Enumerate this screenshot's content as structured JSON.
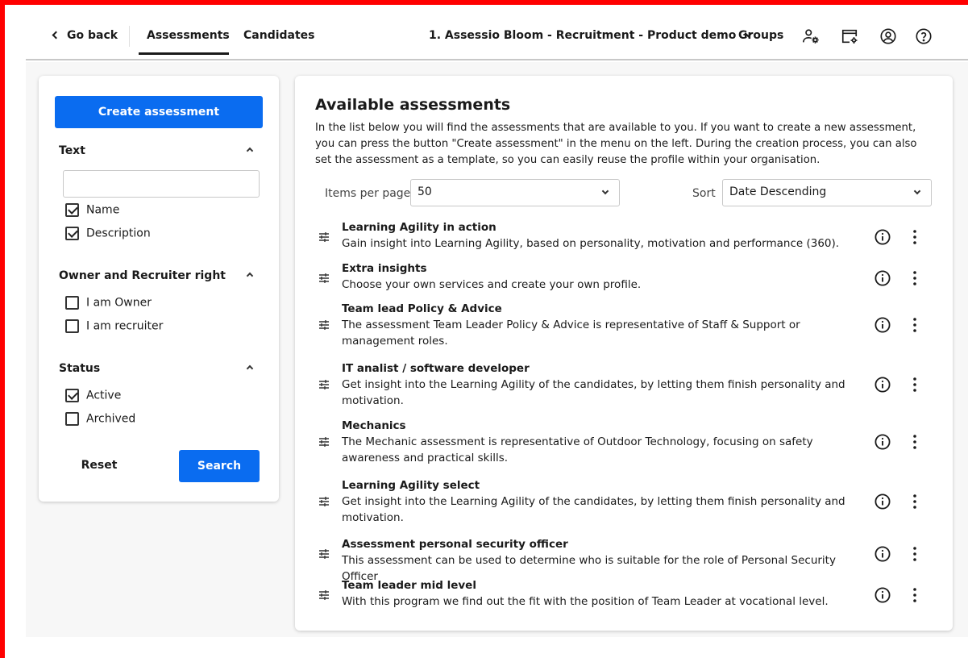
{
  "nav": {
    "back_label": "Go back",
    "tabs": [
      {
        "label": "Assessments",
        "active": true
      },
      {
        "label": "Candidates",
        "active": false
      }
    ],
    "project_label": "1. Assessio Bloom - Recruitment - Product demo",
    "groups_label": "Groups",
    "icons": [
      "user-settings-icon",
      "window-settings-icon",
      "account-icon",
      "help-icon"
    ]
  },
  "sidebar": {
    "create_label": "Create assessment",
    "sections": {
      "text": {
        "title": "Text",
        "input_value": "",
        "options": [
          {
            "label": "Name",
            "checked": true
          },
          {
            "label": "Description",
            "checked": true
          }
        ]
      },
      "owner": {
        "title": "Owner and Recruiter right",
        "options": [
          {
            "label": "I am Owner",
            "checked": false
          },
          {
            "label": "I am recruiter",
            "checked": false
          }
        ]
      },
      "status": {
        "title": "Status",
        "options": [
          {
            "label": "Active",
            "checked": true
          },
          {
            "label": "Archived",
            "checked": false
          }
        ]
      }
    },
    "reset_label": "Reset",
    "search_label": "Search"
  },
  "main": {
    "title": "Available assessments",
    "description": "In the list below you will find the assessments that are available to you. If you want to create a new assessment, you can press the button \"Create assessment\" in the menu on the left. During the creation process, you can also set the assessment as a template, so you can easily reuse the profile within your organisation.",
    "items_per_page_label": "Items per page",
    "items_per_page_value": "50",
    "sort_label": "Sort",
    "sort_value": "Date Descending",
    "items": [
      {
        "title": "Learning Agility in action",
        "description": "Gain insight into Learning Agility, based on personality, motivation and performance (360)."
      },
      {
        "title": "Extra insights",
        "description": "Choose your own services and create your own profile."
      },
      {
        "title": "Team lead Policy & Advice",
        "description": "The assessment Team Leader Policy & Advice is representative of Staff & Support or management roles."
      },
      {
        "title": "IT analist / software developer",
        "description": "Get insight into the Learning Agility of the candidates, by letting them finish personality and motivation."
      },
      {
        "title": "Mechanics",
        "description": "The Mechanic assessment is representative of Outdoor Technology, focusing on safety awareness and practical skills."
      },
      {
        "title": "Learning Agility select",
        "description": "Get insight into the Learning Agility of the candidates, by letting them finish personality and motivation."
      },
      {
        "title": "Assessment personal security officer",
        "description": "This assessment can be used to determine who is suitable for the role of Personal Security Officer"
      },
      {
        "title": "Team leader mid level",
        "description": "With this program we find out the fit with the position of Team Leader at vocational level."
      }
    ]
  }
}
